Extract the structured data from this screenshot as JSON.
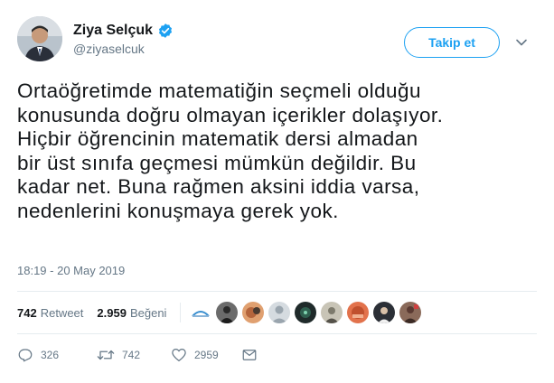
{
  "author": {
    "display_name": "Ziya Selçuk",
    "screen_name": "@ziyaselcuk",
    "verified_icon": "verified-badge-icon"
  },
  "header": {
    "follow_label": "Takip et",
    "menu_icon": "chevron-down-icon"
  },
  "tweet": {
    "text": "Ortaöğretimde matematiğin seçmeli olduğu\nkonusunda doğru olmayan içerikler dolaşıyor.\nHiçbir öğrencinin matematik dersi almadan\nbir üst sınıfa geçmesi mümkün değildir. Bu\nkadar net. Buna rağmen aksini iddia varsa,\nnedenlerini konuşmaya gerek yok.",
    "timestamp": "18:19 - 20 May 2019"
  },
  "stats": {
    "retweets_count": "742",
    "retweets_label": "Retweet",
    "likes_count": "2.959",
    "likes_label": "Beğeni"
  },
  "likers": [
    {
      "name": "liker-1",
      "color": "#8ab4d8"
    },
    {
      "name": "liker-2",
      "color": "#3a3a3a"
    },
    {
      "name": "liker-3",
      "color": "#b5653c"
    },
    {
      "name": "liker-4",
      "color": "#9aa5ae"
    },
    {
      "name": "liker-5",
      "color": "#2f5f4f"
    },
    {
      "name": "liker-6",
      "color": "#7d7a6c"
    },
    {
      "name": "liker-7",
      "color": "#c0502e"
    },
    {
      "name": "liker-8",
      "color": "#2b2f36"
    },
    {
      "name": "liker-9",
      "color": "#5a3a32"
    }
  ],
  "actions": {
    "reply_count": "326",
    "retweet_count": "742",
    "like_count": "2959"
  },
  "colors": {
    "accent": "#1da1f2",
    "text": "#14171a",
    "muted": "#657786",
    "divider": "#e6ecf0"
  }
}
